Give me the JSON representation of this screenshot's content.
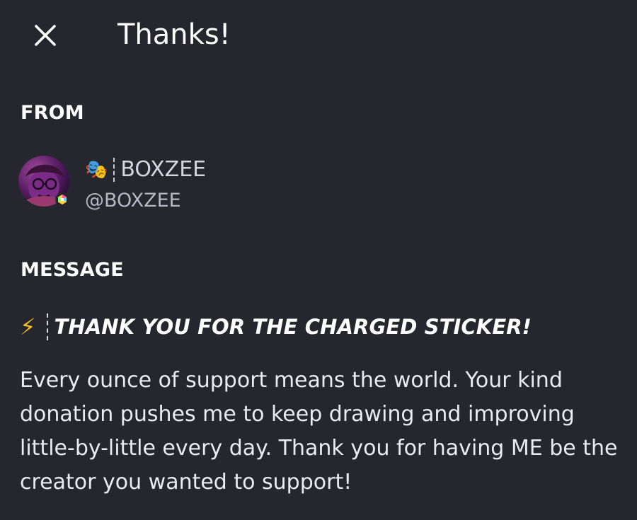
{
  "header": {
    "title": "Thanks!",
    "close_icon": "close-icon"
  },
  "from": {
    "label": "FROM",
    "avatar_icon": "avatar",
    "badge_icon": "nitro-badge-icon",
    "name_emoji": "🎭",
    "display_name": "BOXZEE",
    "handle": "@BOXZEE"
  },
  "message": {
    "label": "MESSAGE",
    "title_emoji": "⚡",
    "title": "THANK YOU FOR THE CHARGED STICKER!",
    "body": "Every ounce of support means the world. Your kind donation pushes me to keep drawing and improving little-by-little every day. Thank you for having ME be the creator you wanted to support!"
  },
  "colors": {
    "background": "#26262f",
    "text_primary": "#ffffff",
    "text_secondary": "#b4b6c2",
    "bolt": "#f6c11c"
  }
}
